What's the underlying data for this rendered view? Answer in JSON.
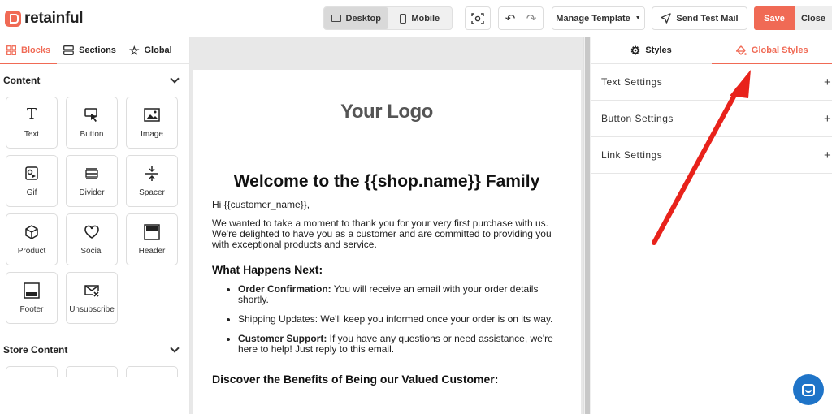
{
  "brand": {
    "name": "retainful",
    "accent": "#f06a55"
  },
  "toolbar": {
    "desktop_label": "Desktop",
    "mobile_label": "Mobile",
    "manage_template_label": "Manage Template",
    "send_test_label": "Send Test Mail",
    "save_label": "Save",
    "close_label": "Close"
  },
  "left_panel": {
    "tabs": [
      {
        "label": "Blocks",
        "icon": "grid-icon",
        "active": true
      },
      {
        "label": "Sections",
        "icon": "sections-icon",
        "active": false
      },
      {
        "label": "Global",
        "icon": "star-icon",
        "active": false
      }
    ],
    "content_heading": "Content",
    "blocks": [
      {
        "label": "Text",
        "icon": "text-icon"
      },
      {
        "label": "Button",
        "icon": "cursor-click-icon"
      },
      {
        "label": "Image",
        "icon": "image-icon"
      },
      {
        "label": "Gif",
        "icon": "gif-icon"
      },
      {
        "label": "Divider",
        "icon": "divider-icon"
      },
      {
        "label": "Spacer",
        "icon": "spacer-icon"
      },
      {
        "label": "Product",
        "icon": "box-icon"
      },
      {
        "label": "Social",
        "icon": "heart-icon"
      },
      {
        "label": "Header",
        "icon": "header-icon"
      },
      {
        "label": "Footer",
        "icon": "footer-icon"
      },
      {
        "label": "Unsubscribe",
        "icon": "mail-x-icon"
      }
    ],
    "store_heading": "Store Content"
  },
  "email": {
    "logo": "Your Logo",
    "title": "Welcome to the {{shop.name}} Family",
    "greeting": "Hi {{customer_name}},",
    "intro": "We wanted to take a moment to thank you for your very first purchase with us. We're delighted to have you as a customer and are committed to providing you with exceptional products and service.",
    "next_heading": "What Happens Next:",
    "bullets": [
      {
        "bold": "Order Confirmation:",
        "text": " You will receive an email with your order details shortly."
      },
      {
        "bold": "",
        "text": "Shipping Updates: We'll keep you informed once your order is on its way."
      },
      {
        "bold": "Customer Support:",
        "text": " If you have any questions or need assistance, we're here to help! Just reply to this email."
      }
    ],
    "benefits_heading": "Discover the Benefits of Being our Valued Customer:"
  },
  "right_panel": {
    "tabs": [
      {
        "label": "Styles",
        "icon": "gear-icon",
        "active": false
      },
      {
        "label": "Global Styles",
        "icon": "paint-bucket-icon",
        "active": true
      }
    ],
    "settings": [
      "Text Settings",
      "Button Settings",
      "Link Settings"
    ]
  },
  "annotation_color": "#e8221b",
  "chat_color": "#1f74c8"
}
